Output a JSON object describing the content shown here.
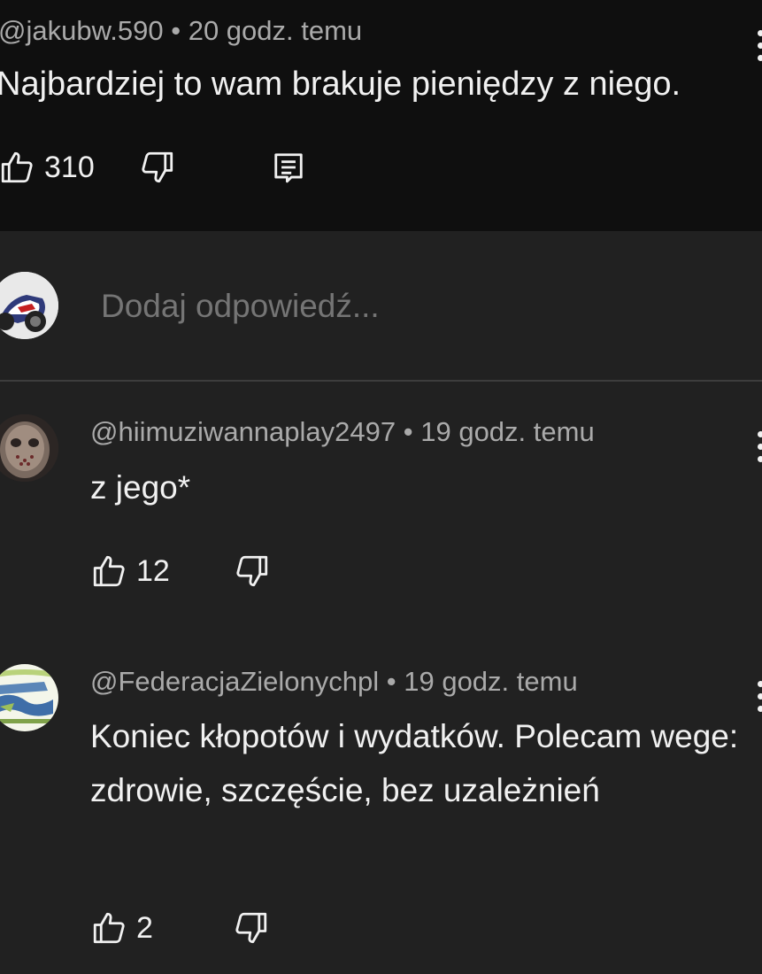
{
  "parent_comment": {
    "author": "@jakubw.590",
    "time": "20 godz. temu",
    "text": "Najbardziej to wam brakuje pieniędzy z niego.",
    "likes": "310",
    "icons": {
      "like": "thumb-up-icon",
      "dislike": "thumb-down-icon",
      "reply": "comment-icon",
      "more": "more-vertical-icon"
    }
  },
  "reply_box": {
    "placeholder": "Dodaj odpowiedź..."
  },
  "replies": [
    {
      "author": "@hiimuziwannaplay2497",
      "time": "19 godz. temu",
      "text": "z jego*",
      "likes": "12"
    },
    {
      "author": "@FederacjaZielonychpl",
      "time": "19 godz. temu",
      "text": "Koniec kłopotów i wydatków. Polecam wege: zdrowie, szczęście, bez uzależnień",
      "likes": "2"
    }
  ],
  "separator": "•",
  "colors": {
    "background": "#212121",
    "parent_background": "#0f0f0f",
    "text_primary": "#f1f1f1",
    "text_secondary": "#aaaaaa"
  }
}
